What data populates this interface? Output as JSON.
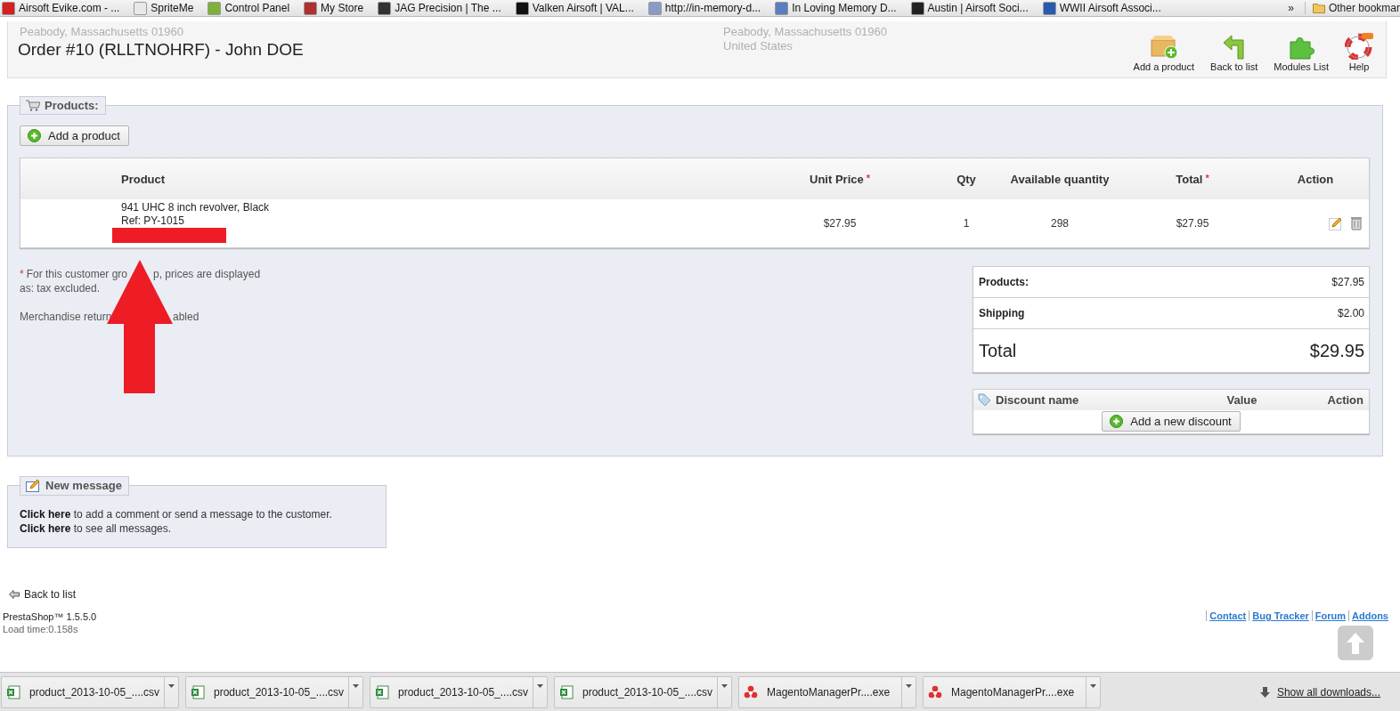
{
  "bookmarks": [
    {
      "label": "Airsoft Evike.com - ...",
      "color": "#d42020"
    },
    {
      "label": "SpriteMe",
      "color": "#e8e8e8"
    },
    {
      "label": "Control Panel",
      "color": "#7fb03a"
    },
    {
      "label": "My Store",
      "color": "#b03030"
    },
    {
      "label": "JAG Precision | The ...",
      "color": "#333333"
    },
    {
      "label": "Valken Airsoft | VAL...",
      "color": "#111111"
    },
    {
      "label": "http://in-memory-d...",
      "color": "#8a9ac8"
    },
    {
      "label": "In Loving Memory D...",
      "color": "#5a7fc0"
    },
    {
      "label": "Austin | Airsoft Soci...",
      "color": "#222222"
    },
    {
      "label": "WWII Airsoft Associ...",
      "color": "#2a5ab0"
    }
  ],
  "bookmarks_more": "»",
  "other_bookmarks": "Other bookmar",
  "header": {
    "title": "Order #10 (RLLTNOHRF) - John DOE",
    "faded_left": [
      "Peabody, Massachusetts 01960"
    ],
    "faded_right": [
      "Peabody, Massachusetts 01960",
      "United States"
    ],
    "toolbar": [
      {
        "label": "Add a product",
        "kind": "add"
      },
      {
        "label": "Back to list",
        "kind": "back"
      },
      {
        "label": "Modules List",
        "kind": "modules"
      },
      {
        "label": "Help",
        "kind": "help"
      }
    ]
  },
  "products": {
    "legend": "Products:",
    "add_button": "Add a product",
    "columns": [
      {
        "label": "Product"
      },
      {
        "label": "Unit Price",
        "mark": "*"
      },
      {
        "label": "Qty"
      },
      {
        "label": "Available quantity"
      },
      {
        "label": "Total",
        "mark": "*"
      },
      {
        "label": "Action"
      }
    ],
    "rows": [
      {
        "name": "941 UHC 8 inch revolver, Black",
        "ref": "Ref: PY-1015",
        "unit_price": "$27.95",
        "qty": "1",
        "available": "298",
        "total": "$27.95"
      }
    ],
    "note": {
      "mark": "*",
      "line1": [
        "For this customer gro",
        "p, prices are displayed"
      ],
      "line2": "as: tax excluded.",
      "line3": [
        "Merchandise return",
        "abled"
      ]
    },
    "totals": [
      {
        "label": "Products:",
        "value": "$27.95",
        "kind": "sub"
      },
      {
        "label": "Shipping",
        "value": "$2.00",
        "kind": "sub"
      },
      {
        "label": "Total",
        "value": "$29.95",
        "kind": "grand"
      }
    ],
    "discounts": {
      "columns": [
        "Discount name",
        "Value",
        "Action"
      ],
      "button": "Add a new discount"
    }
  },
  "message": {
    "legend": "New message",
    "lines": [
      {
        "link": "Click here",
        "text": " to add a comment or send a message to the customer."
      },
      {
        "link": "Click here",
        "text": " to see all messages."
      }
    ]
  },
  "back_link": "Back to list",
  "footer": {
    "product": "PrestaShop™ 1.5.5.0",
    "load_time": "Load time:0.158s",
    "links": [
      "Contact",
      "Bug Tracker",
      "Forum",
      "Addons"
    ]
  },
  "downloads": [
    {
      "name": "product_2013-10-05_....csv",
      "kind": "csv"
    },
    {
      "name": "product_2013-10-05_....csv",
      "kind": "csv"
    },
    {
      "name": "product_2013-10-05_....csv",
      "kind": "csv"
    },
    {
      "name": "product_2013-10-05_....csv",
      "kind": "csv"
    },
    {
      "name": "MagentoManagerPr....exe",
      "kind": "exe"
    },
    {
      "name": "MagentoManagerPr....exe",
      "kind": "exe"
    }
  ],
  "show_all": "Show all downloads..."
}
